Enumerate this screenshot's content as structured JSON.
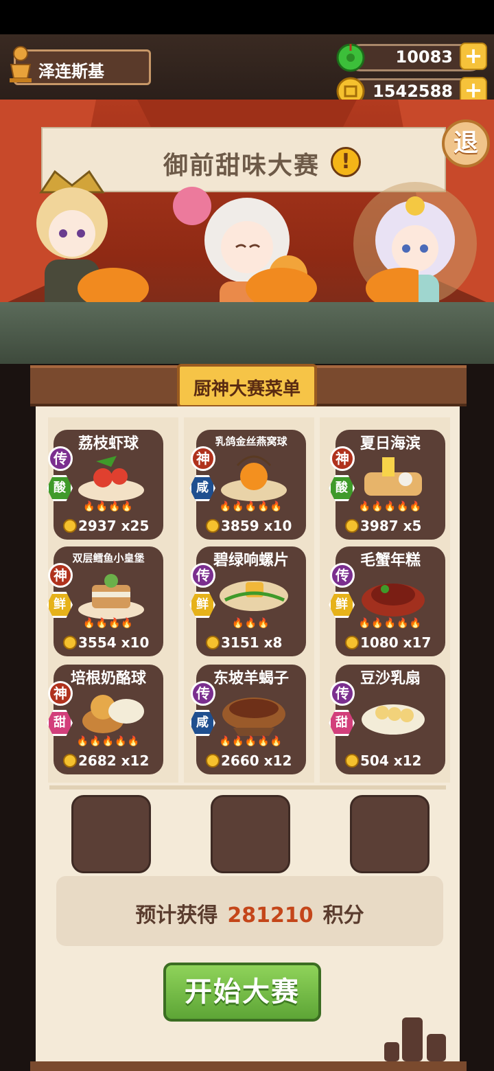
{
  "player": {
    "name": "泽连斯基"
  },
  "currency": {
    "jade": {
      "value": "10083",
      "plus": "+"
    },
    "coins": {
      "value": "1542588",
      "plus": "+"
    }
  },
  "stage": {
    "banner_title": "御前甜味大赛",
    "exit_label": "退",
    "info_label": "!"
  },
  "menu": {
    "title": "厨神大赛菜单",
    "dishes": [
      {
        "name": "荔枝虾球",
        "rank": "传",
        "taste": "酸",
        "price": "2937",
        "qty": "x25"
      },
      {
        "name": "乳鸽金丝燕窝球",
        "rank": "神",
        "taste": "咸",
        "price": "3859",
        "qty": "x10"
      },
      {
        "name": "夏日海滨",
        "rank": "神",
        "taste": "酸",
        "price": "3987",
        "qty": "x5"
      },
      {
        "name": "双层鳕鱼小皇堡",
        "rank": "神",
        "taste": "鲜",
        "price": "3554",
        "qty": "x10"
      },
      {
        "name": "碧绿响螺片",
        "rank": "传",
        "taste": "鲜",
        "price": "3151",
        "qty": "x8"
      },
      {
        "name": "毛蟹年糕",
        "rank": "传",
        "taste": "鲜",
        "price": "1080",
        "qty": "x17"
      },
      {
        "name": "培根奶酪球",
        "rank": "神",
        "taste": "甜",
        "price": "2682",
        "qty": "x12"
      },
      {
        "name": "东坡羊蝎子",
        "rank": "传",
        "taste": "咸",
        "price": "2660",
        "qty": "x12"
      },
      {
        "name": "豆沙乳扇",
        "rank": "传",
        "taste": "甜",
        "price": "504",
        "qty": "x12"
      }
    ]
  },
  "estimate": {
    "prefix": "预计获得",
    "value": "281210",
    "suffix": "积分"
  },
  "start_button": "开始大赛",
  "colors": {
    "sour": "#3f9a2a",
    "salty": "#1f4f8f",
    "fresh": "#e6b21a",
    "sweet": "#d23f7b"
  }
}
